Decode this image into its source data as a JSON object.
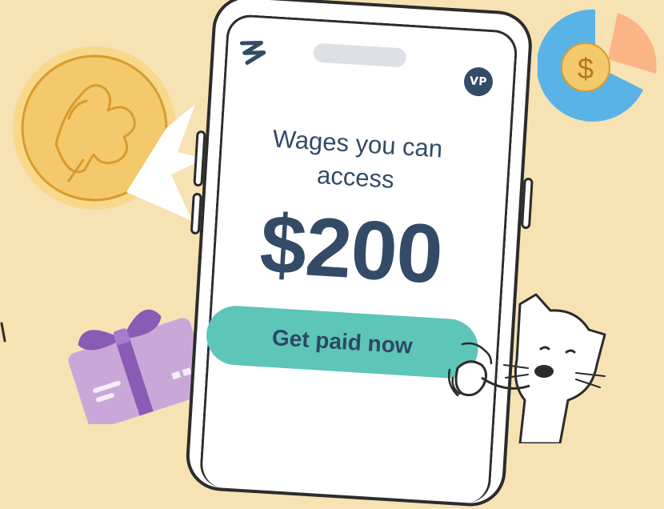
{
  "app": {
    "logo_icon": "zigzag-logo-icon",
    "avatar_initials": "VP"
  },
  "wages": {
    "headline": "Wages you can access",
    "amount": "$200",
    "cta_label": "Get paid now"
  },
  "decorations": {
    "coin_icon": "gold-coin-icon",
    "pie_icon": "pie-chart-dollar-icon",
    "pie_symbol": "$",
    "gift_icon": "gift-card-icon",
    "cat_icon": "cat-illustration"
  },
  "colors": {
    "background": "#f6e2b3",
    "primary_text": "#334b66",
    "cta": "#5ec5b9",
    "coin": "#f3c96b",
    "pie_blue": "#5ab3e6",
    "pie_peach": "#fbb486",
    "gift": "#c9a8d9"
  }
}
